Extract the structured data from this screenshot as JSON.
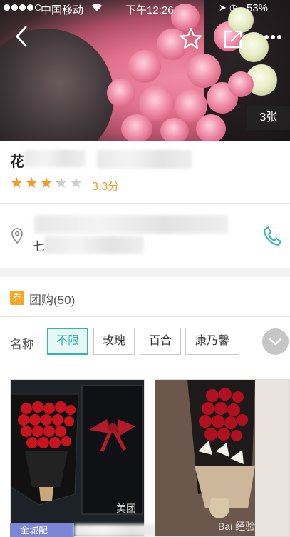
{
  "status_bar": {
    "carrier": "中国移动",
    "time": "下午12:26",
    "battery": "53%"
  },
  "hero": {
    "photo_count": "3张"
  },
  "shop": {
    "name_visible": "花",
    "rating": 3.3,
    "rating_max": 5,
    "score_text": "3.3分",
    "star_color": "#f39a2b"
  },
  "address": {
    "partial_text": "七"
  },
  "group_buy": {
    "badge": "券",
    "title": "团购(50)",
    "filter_label": "名称",
    "filters": [
      "不限",
      "玫瑰",
      "百合",
      "康乃馨"
    ],
    "selected_filter": "不限",
    "accent_color": "#2fb8a9"
  },
  "products": {
    "card1_tag": "全城配",
    "card1_watermark": "美团",
    "card2_watermark": "Bai 经验"
  }
}
